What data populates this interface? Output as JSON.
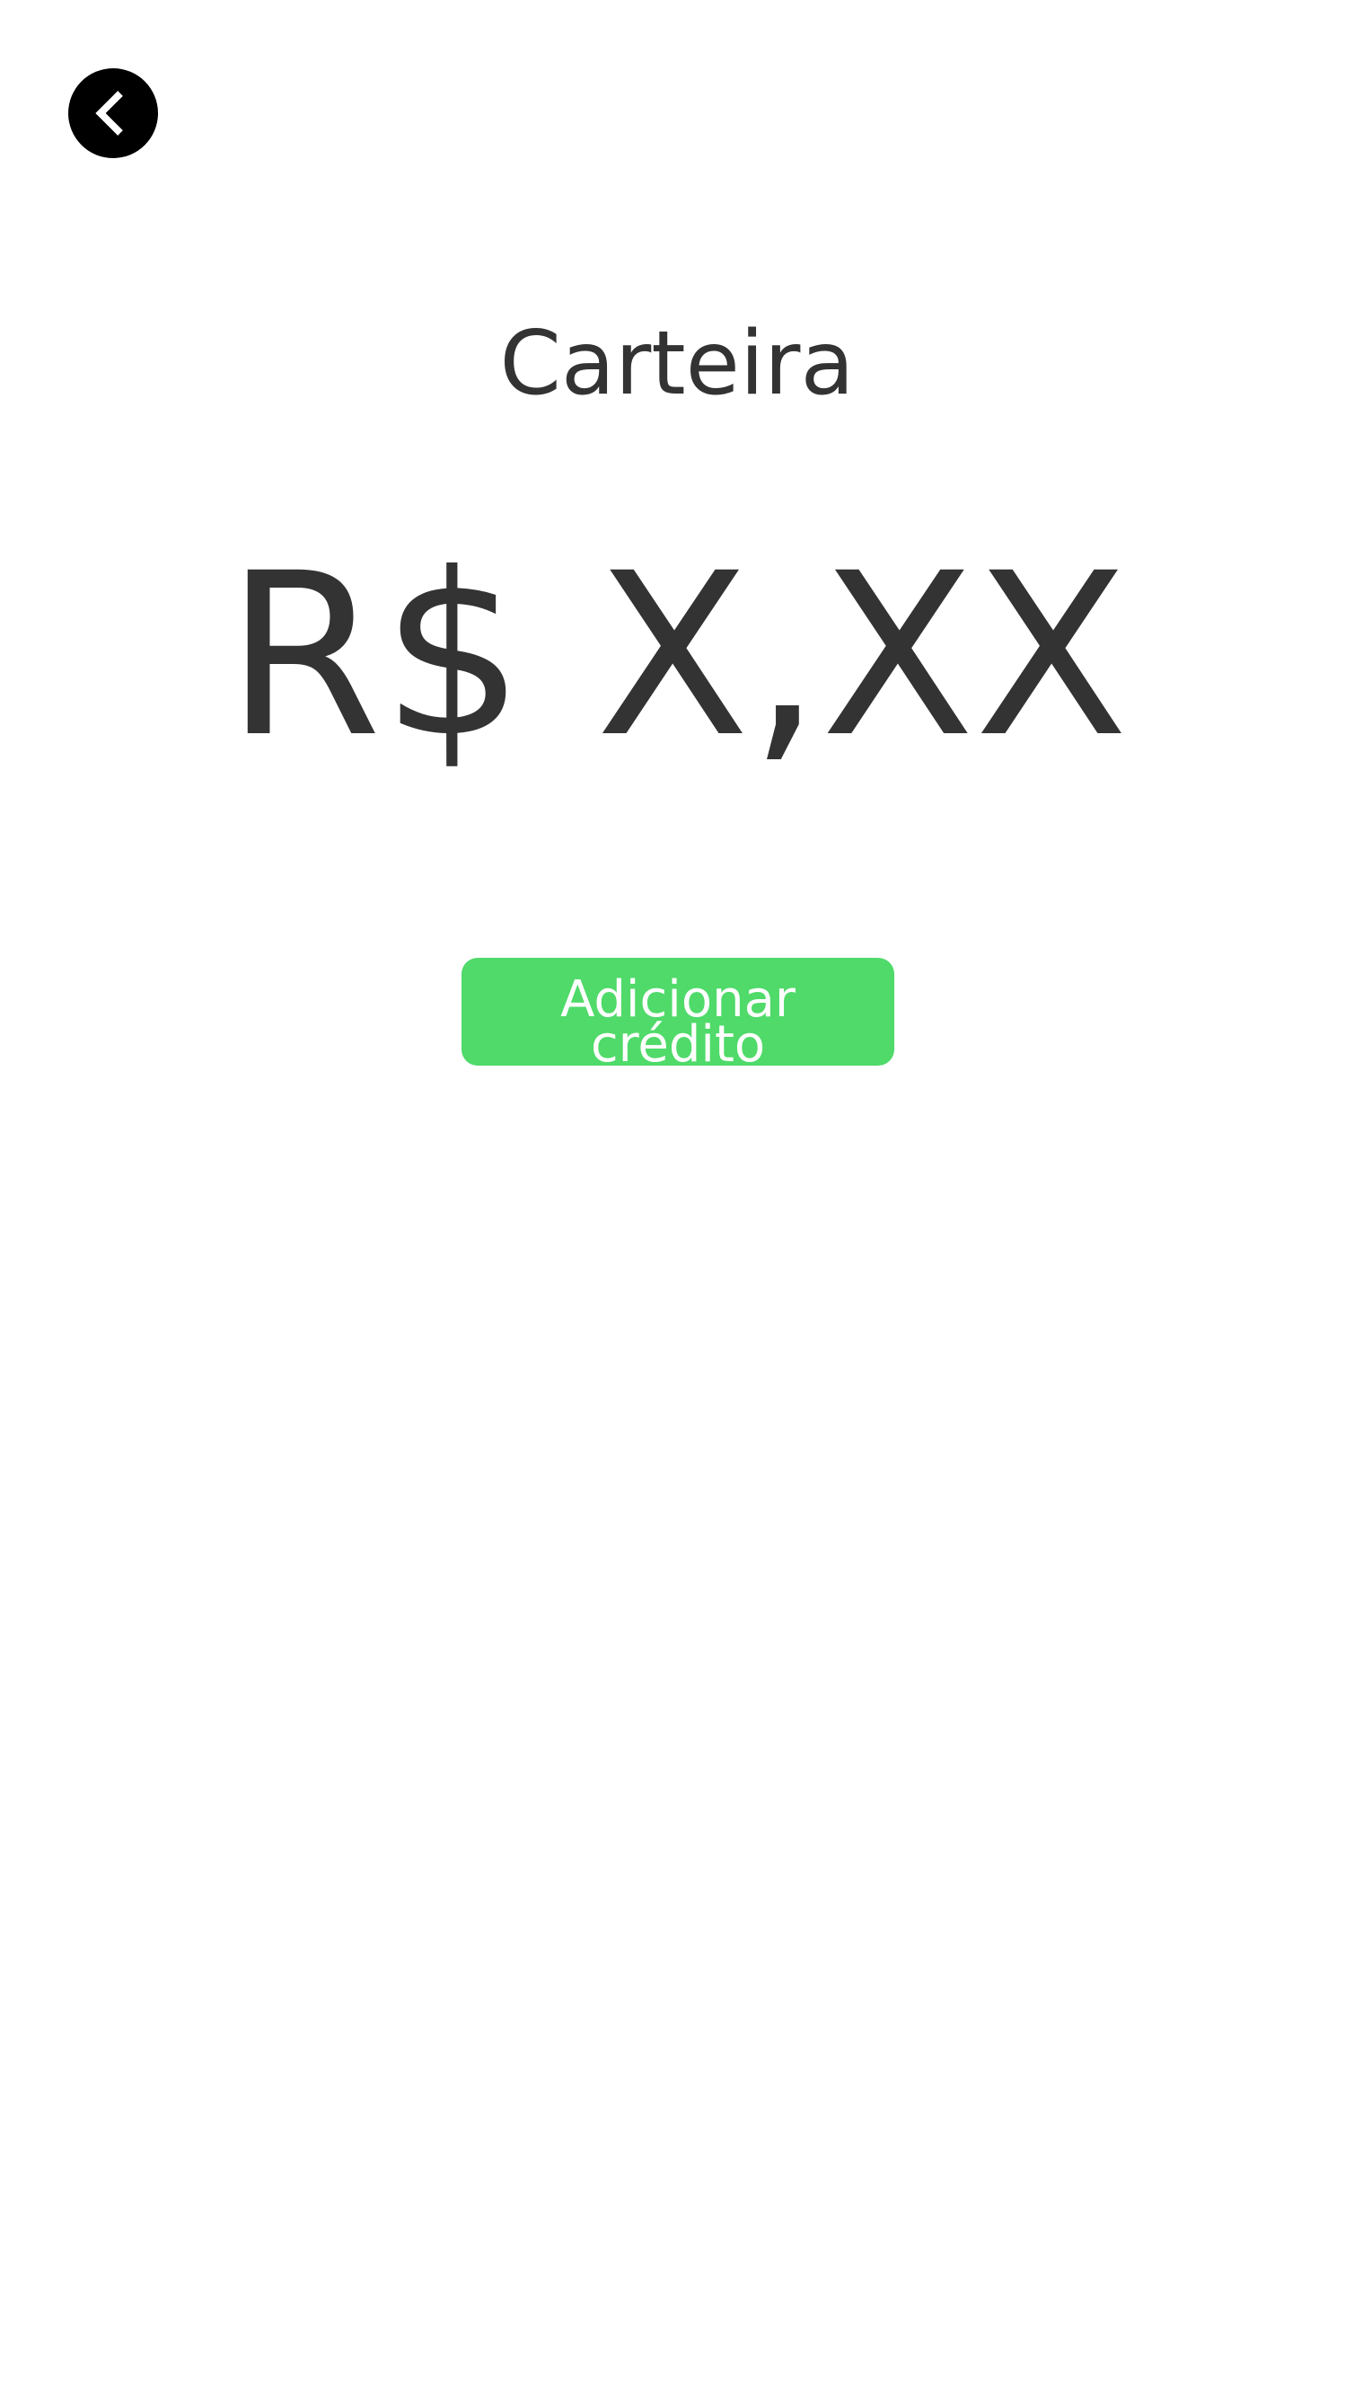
{
  "header": {
    "back_icon": "chevron-left-icon",
    "title": "Carteira"
  },
  "wallet": {
    "balance": "R$ X,XX"
  },
  "actions": {
    "add_credit_label": "Adicionar crédito"
  },
  "colors": {
    "background": "#ffffff",
    "text": "#333333",
    "back_button": "#000000",
    "accent_green": "#4fda69",
    "button_text": "#ffffff"
  }
}
